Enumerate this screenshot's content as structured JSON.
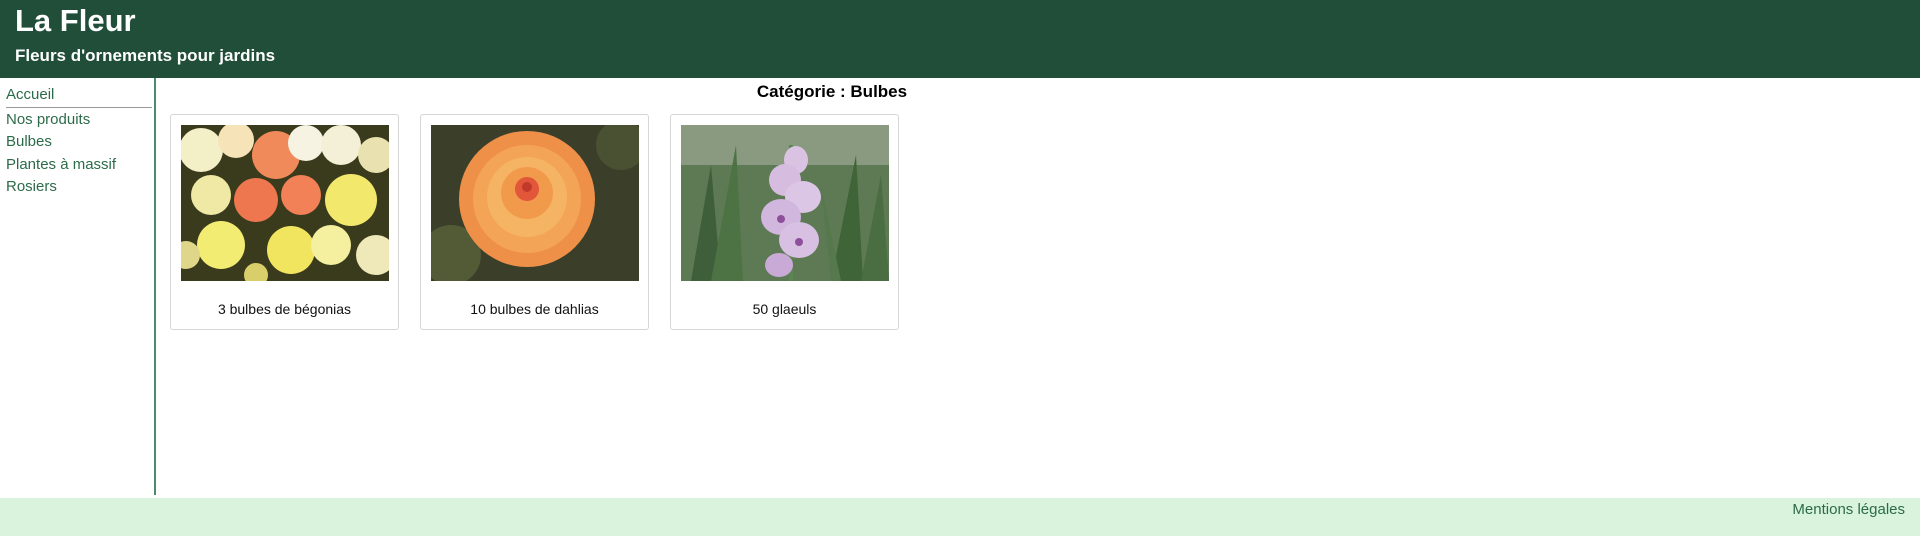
{
  "header": {
    "title": "La Fleur",
    "subtitle": "Fleurs d'ornements pour jardins",
    "background": "#214e38"
  },
  "sidebar": {
    "items": [
      {
        "label": "Accueil"
      },
      {
        "label": "Nos produits"
      },
      {
        "label": "Bulbes"
      },
      {
        "label": "Plantes à massif"
      },
      {
        "label": "Rosiers"
      }
    ],
    "link_color": "#2c6b49"
  },
  "main": {
    "category_title": "Catégorie : Bulbes",
    "products": [
      {
        "name": "3 bulbes de bégonias",
        "image": "begonias-photo"
      },
      {
        "name": "10 bulbes de dahlias",
        "image": "dahlia-photo"
      },
      {
        "name": "50 glaeuls",
        "image": "gladiolus-photo"
      }
    ]
  },
  "footer": {
    "legal_link": "Mentions légales",
    "background": "#d9f3dd"
  }
}
